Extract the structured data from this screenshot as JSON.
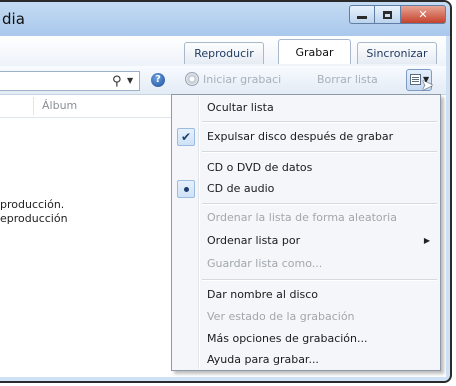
{
  "window": {
    "title": "dia"
  },
  "tabs": [
    {
      "label": "Reproducir"
    },
    {
      "label": "Grabar"
    },
    {
      "label": "Sincronizar"
    }
  ],
  "toolbar": {
    "burn_label": "Iniciar grabaci",
    "clear_label": "Borrar lista"
  },
  "columns": {
    "album": "Álbum"
  },
  "messages": {
    "line1": "producción.",
    "line2": "eproducción"
  },
  "menu": {
    "items": [
      {
        "label": "Ocultar lista",
        "state": "none",
        "enabled": true
      },
      {
        "label": "Expulsar disco después de grabar",
        "state": "check",
        "enabled": true
      },
      {
        "label": "CD o DVD de datos",
        "state": "none",
        "enabled": true
      },
      {
        "label": "CD de audio",
        "state": "radio",
        "enabled": true
      },
      {
        "label": "Ordenar la lista de forma aleatoria",
        "state": "none",
        "enabled": false
      },
      {
        "label": "Ordenar lista por",
        "state": "none",
        "enabled": true,
        "submenu": true
      },
      {
        "label": "Guardar lista como...",
        "state": "none",
        "enabled": false
      },
      {
        "label": "Dar nombre al disco",
        "state": "none",
        "enabled": true
      },
      {
        "label": "Ver estado de la grabación",
        "state": "none",
        "enabled": false
      },
      {
        "label": "Más opciones de grabación...",
        "state": "none",
        "enabled": true
      },
      {
        "label": "Ayuda para grabar...",
        "state": "none",
        "enabled": true
      }
    ]
  }
}
